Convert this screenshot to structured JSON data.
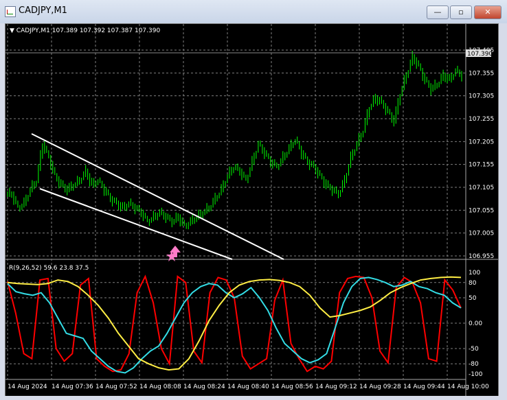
{
  "window": {
    "title": "CADJPY,M1",
    "minimize_label": "—",
    "restore_label": "▫",
    "close_label": "✕"
  },
  "chart": {
    "header": "▼ CADJPY,M1  107.389 107.392 107.387 107.390",
    "current_price_tag": "107.390",
    "indicator_label": "R(9,26,52) 59.6 23.8 37.5",
    "colors": {
      "background": "#000000",
      "candle_up": "#00ff00",
      "trendline": "#ffffff",
      "grid": "#808080",
      "red_line": "#ff0000",
      "cyan_line": "#33dde6",
      "yellow_line": "#ffee44",
      "arrow": "#ff7cc8"
    }
  },
  "chart_data": [
    {
      "type": "line",
      "series": [
        {
          "values": [
            107.09,
            107.06,
            107.07,
            107.1,
            107.12,
            107.2,
            107.17,
            107.13,
            107.11,
            107.1,
            107.11,
            107.12,
            107.14,
            107.11,
            107.12,
            107.1,
            107.08,
            107.07,
            107.06,
            107.07,
            107.06,
            107.05,
            107.03,
            107.04,
            107.05,
            107.04,
            107.03,
            107.04,
            107.02,
            107.03,
            107.04,
            107.05,
            107.06,
            107.08,
            107.1,
            107.13,
            107.15,
            107.14,
            107.12,
            107.16,
            107.2,
            107.18,
            107.16,
            107.15,
            107.17,
            107.19,
            107.21,
            107.18,
            107.16,
            107.15,
            107.13,
            107.11,
            107.1,
            107.09,
            107.12,
            107.17,
            107.2,
            107.23,
            107.28,
            107.3,
            107.29,
            107.27,
            107.25,
            107.31,
            107.35,
            107.39,
            107.37,
            107.34,
            107.32,
            107.33,
            107.35,
            107.34,
            107.36,
            107.35
          ]
        }
      ],
      "ylim": [
        106.955,
        107.405
      ],
      "y_ticks": [
        "107.405",
        "107.355",
        "107.305",
        "107.255",
        "107.205",
        "107.155",
        "107.105",
        "107.055",
        "107.005",
        "106.955"
      ]
    },
    {
      "type": "line",
      "series": [
        {
          "values": [
            82,
            20,
            -60,
            -70,
            85,
            88,
            -50,
            -75,
            -60,
            75,
            88,
            -70,
            -85,
            -95,
            -92,
            -60,
            60,
            92,
            40,
            -50,
            -80,
            92,
            80,
            -55,
            -78,
            60,
            90,
            85,
            50,
            -65,
            -90,
            -80,
            -70,
            45,
            85,
            -40,
            -70,
            -95,
            -85,
            -90,
            -75,
            60,
            88,
            92,
            90,
            50,
            -55,
            -78,
            70,
            90,
            80,
            40,
            -70,
            -75,
            85,
            65,
            30
          ]
        },
        {
          "values": [
            78,
            62,
            58,
            55,
            60,
            40,
            10,
            -20,
            -25,
            -30,
            -55,
            -70,
            -85,
            -95,
            -98,
            -88,
            -70,
            -55,
            -45,
            -20,
            10,
            40,
            60,
            72,
            78,
            75,
            60,
            50,
            58,
            70,
            50,
            25,
            -10,
            -40,
            -55,
            -70,
            -78,
            -72,
            -60,
            -10,
            40,
            72,
            88,
            90,
            86,
            80,
            72,
            75,
            82,
            72,
            68,
            60,
            55,
            40,
            30
          ]
        },
        {
          "values": [
            80,
            78,
            77,
            76,
            78,
            85,
            82,
            72,
            55,
            35,
            10,
            -20,
            -45,
            -70,
            -80,
            -88,
            -92,
            -90,
            -70,
            -35,
            5,
            35,
            60,
            75,
            82,
            85,
            86,
            84,
            80,
            72,
            55,
            30,
            12,
            15,
            20,
            25,
            32,
            45,
            60,
            70,
            78,
            85,
            88,
            90,
            91,
            90
          ]
        }
      ],
      "ylim": [
        -100,
        100
      ],
      "y_ticks": [
        "100",
        "80",
        "50",
        "0.00",
        "-50",
        "-80",
        "-100"
      ]
    }
  ],
  "time_axis": [
    "14 Aug 2024",
    "14 Aug 07:36",
    "14 Aug 07:52",
    "14 Aug 08:08",
    "14 Aug 08:24",
    "14 Aug 08:40",
    "14 Aug 08:56",
    "14 Aug 09:12",
    "14 Aug 09:28",
    "14 Aug 09:44",
    "14 Aug 10:00"
  ],
  "indicator_ticks": [
    "100",
    "80",
    "50",
    "0.00",
    "-50",
    "-80",
    "-100"
  ]
}
